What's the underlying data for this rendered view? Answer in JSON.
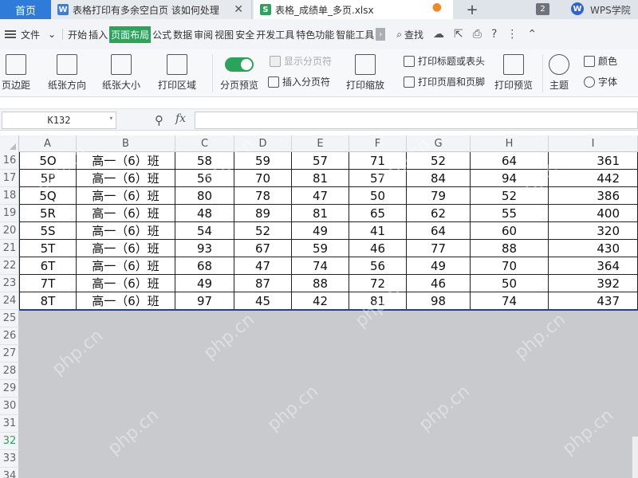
{
  "tabs": {
    "home": "首页",
    "doc": "表格打印有多余空白页 该如何处理",
    "xlsx": "表格_成绩单_多页.xlsx",
    "count": "2",
    "brand": "WPS学院"
  },
  "menubar": {
    "file": "文件",
    "items": [
      "开始",
      "插入",
      "页面布局",
      "公式",
      "数据",
      "审阅",
      "视图",
      "安全",
      "开发工具",
      "特色功能",
      "智能工具"
    ],
    "active": "页面布局",
    "search": "查找"
  },
  "ribbon": {
    "margins": "页边距",
    "orientation": "纸张方向",
    "size": "纸张大小",
    "print_area": "打印区域",
    "page_break_preview": "分页预览",
    "show_page_breaks": "显示分页符",
    "insert_page_break": "插入分页符",
    "print_scaling": "打印缩放",
    "print_titles": "打印标题或表头",
    "header_footer": "打印页眉和页脚",
    "print_preview": "打印预览",
    "theme": "主题",
    "colors": "颜色",
    "fonts": "字体"
  },
  "formula": {
    "cell_ref": "K132",
    "fx": "fx",
    "value": ""
  },
  "sheet": {
    "columns": [
      "A",
      "B",
      "C",
      "D",
      "E",
      "F",
      "G",
      "H",
      "I"
    ],
    "rows": [
      {
        "num": "16",
        "cells": [
          "5O",
          "高一（6）班",
          "58",
          "59",
          "57",
          "71",
          "52",
          "64",
          "361"
        ]
      },
      {
        "num": "17",
        "cells": [
          "5P",
          "高一（6）班",
          "56",
          "70",
          "81",
          "57",
          "84",
          "94",
          "442"
        ]
      },
      {
        "num": "18",
        "cells": [
          "5Q",
          "高一（6）班",
          "80",
          "78",
          "47",
          "50",
          "79",
          "52",
          "386"
        ]
      },
      {
        "num": "19",
        "cells": [
          "5R",
          "高一（6）班",
          "48",
          "89",
          "81",
          "65",
          "62",
          "55",
          "400"
        ]
      },
      {
        "num": "20",
        "cells": [
          "5S",
          "高一（6）班",
          "54",
          "52",
          "49",
          "41",
          "64",
          "60",
          "320"
        ]
      },
      {
        "num": "21",
        "cells": [
          "5T",
          "高一（6）班",
          "93",
          "67",
          "59",
          "46",
          "77",
          "88",
          "430"
        ]
      },
      {
        "num": "22",
        "cells": [
          "6T",
          "高一（6）班",
          "68",
          "47",
          "74",
          "56",
          "49",
          "70",
          "364"
        ]
      },
      {
        "num": "23",
        "cells": [
          "7T",
          "高一（6）班",
          "49",
          "87",
          "88",
          "72",
          "46",
          "50",
          "392"
        ]
      },
      {
        "num": "24",
        "cells": [
          "8T",
          "高一（6）班",
          "97",
          "45",
          "42",
          "81",
          "98",
          "74",
          "437"
        ]
      }
    ],
    "empty_rows": [
      "25",
      "26",
      "27",
      "28",
      "29",
      "30",
      "31",
      "32",
      "33",
      "34"
    ],
    "selected_row": "32"
  },
  "watermark": "php.cn"
}
